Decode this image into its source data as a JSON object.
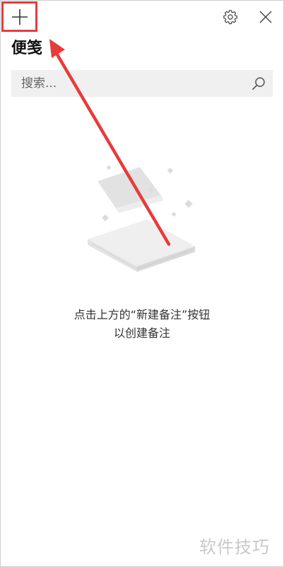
{
  "app": {
    "title": "便笺"
  },
  "titlebar": {
    "new_note_icon": "plus-icon",
    "settings_icon": "gear-icon",
    "close_icon": "close-icon"
  },
  "search": {
    "placeholder": "搜索...",
    "icon": "search-icon"
  },
  "empty_state": {
    "line1": "点击上方的“新建备注”按钮",
    "line2": "以创建备注"
  },
  "annotation": {
    "highlight_color": "#e63c3c"
  },
  "watermark": {
    "text": "软件技巧"
  }
}
